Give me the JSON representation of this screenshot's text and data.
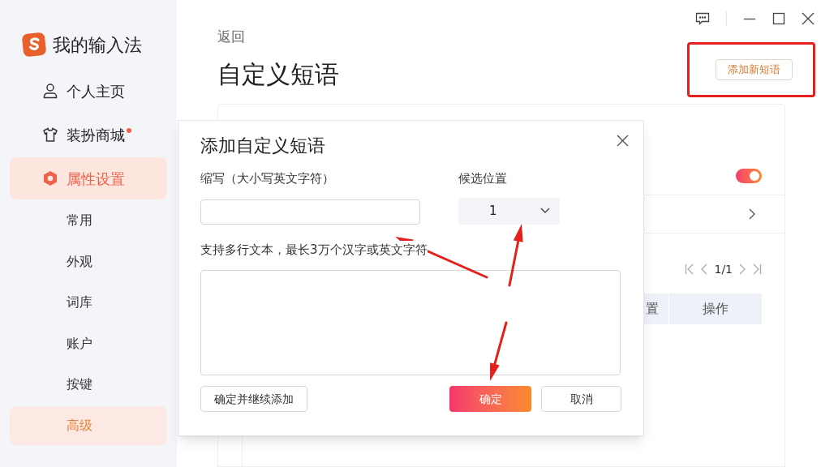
{
  "app": {
    "title": "我的输入法"
  },
  "sidebar": {
    "items": [
      {
        "label": "个人主页",
        "kind": "user",
        "selected": false,
        "dot": false
      },
      {
        "label": "装扮商城",
        "kind": "shirt",
        "selected": false,
        "dot": true
      },
      {
        "label": "属性设置",
        "kind": "settings",
        "selected": true,
        "dot": false,
        "children": [
          {
            "label": "常用",
            "selected": false
          },
          {
            "label": "外观",
            "selected": false
          },
          {
            "label": "词库",
            "selected": false
          },
          {
            "label": "账户",
            "selected": false
          },
          {
            "label": "按键",
            "selected": false
          },
          {
            "label": "高级",
            "selected": true
          }
        ]
      }
    ]
  },
  "main": {
    "back_link": "返回",
    "page_title": "自定义短语",
    "add_button": "添加新短语",
    "card": {
      "toggle": {
        "on": true
      },
      "pagination": {
        "page": "1/1"
      },
      "table": {
        "columns": [
          "置",
          "操作"
        ]
      }
    }
  },
  "dialog": {
    "title": "添加自定义短语",
    "abbr_label": "缩写（大小写英文字符）",
    "position_label": "候选位置",
    "position_value": "1",
    "text_label": "支持多行文本，最长3万个汉字或英文字符",
    "buttons": [
      {
        "label": "确定并继续添加",
        "kind": "secondary"
      },
      {
        "label": "确定",
        "kind": "primary"
      },
      {
        "label": "取消",
        "kind": "secondary"
      }
    ]
  }
}
